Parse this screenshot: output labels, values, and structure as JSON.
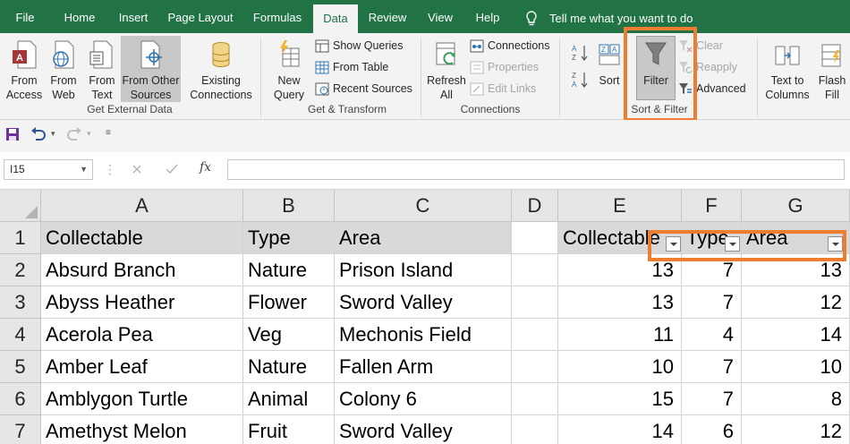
{
  "tabs": [
    "File",
    "Home",
    "Insert",
    "Page Layout",
    "Formulas",
    "Data",
    "Review",
    "View",
    "Help"
  ],
  "active_tab": "Data",
  "tell_me": "Tell me what you want to do",
  "ribbon": {
    "get_external": {
      "from_access": "From\nAccess",
      "from_web": "From\nWeb",
      "from_text": "From\nText",
      "from_other": "From Other\nSources",
      "existing": "Existing\nConnections",
      "label": "Get External Data"
    },
    "transform": {
      "new_query": "New\nQuery",
      "show_queries": "Show Queries",
      "from_table": "From Table",
      "recent_sources": "Recent Sources",
      "label": "Get & Transform"
    },
    "connections": {
      "refresh_all": "Refresh\nAll",
      "connections": "Connections",
      "properties": "Properties",
      "edit_links": "Edit Links",
      "label": "Connections"
    },
    "sort_filter": {
      "sort": "Sort",
      "filter": "Filter",
      "clear": "Clear",
      "reapply": "Reapply",
      "advanced": "Advanced",
      "label": "Sort & Filter"
    },
    "data_tools": {
      "text_to_columns": "Text to\nColumns",
      "flash_fill": "Flash\nFill"
    }
  },
  "formula_bar": {
    "name_box": "I15",
    "formula": ""
  },
  "columns": [
    "A",
    "B",
    "C",
    "D",
    "E",
    "F",
    "G"
  ],
  "rows": [
    "1",
    "2",
    "3",
    "4",
    "5",
    "6",
    "7"
  ],
  "table": {
    "headers": [
      "Collectable",
      "Type",
      "Area"
    ],
    "records": [
      [
        "Absurd Branch",
        "Nature",
        "Prison Island"
      ],
      [
        "Abyss Heather",
        "Flower",
        "Sword Valley"
      ],
      [
        "Acerola Pea",
        "Veg",
        "Mechonis Field"
      ],
      [
        "Amber Leaf",
        "Nature",
        "Fallen Arm"
      ],
      [
        "Amblygon Turtle",
        "Animal",
        "Colony 6"
      ],
      [
        "Amethyst Melon",
        "Fruit",
        "Sword Valley"
      ]
    ]
  },
  "length_table": {
    "headers": [
      "Collectable",
      "Type",
      "Area"
    ],
    "records": [
      [
        "13",
        "7",
        "13"
      ],
      [
        "13",
        "7",
        "12"
      ],
      [
        "11",
        "4",
        "14"
      ],
      [
        "10",
        "7",
        "10"
      ],
      [
        "15",
        "7",
        "8"
      ],
      [
        "14",
        "6",
        "12"
      ]
    ]
  },
  "colors": {
    "excel_green": "#217346",
    "highlight_orange": "#ed7d31",
    "header_gray": "#d9d9d9"
  }
}
